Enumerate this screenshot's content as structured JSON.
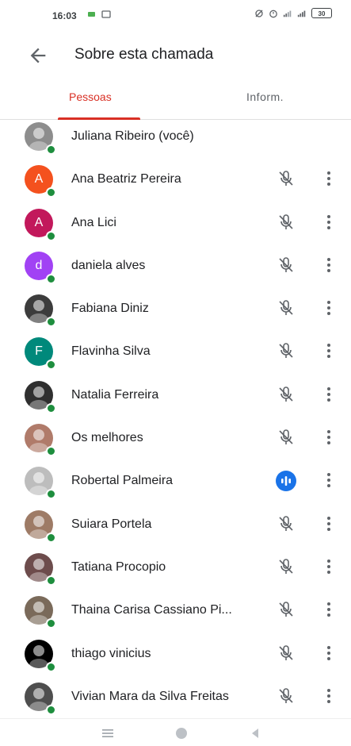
{
  "status_bar": {
    "time": "16:03",
    "battery": "30"
  },
  "header": {
    "title": "Sobre esta chamada",
    "back_icon": "arrow-back-icon"
  },
  "tabs": [
    {
      "label": "Pessoas",
      "active": true
    },
    {
      "label": "Inform.",
      "active": false
    }
  ],
  "participants": [
    {
      "name": "Juliana Ribeiro (você)",
      "avatar_type": "photo",
      "avatar_color": "#8d8d8d",
      "initial": "",
      "mic": "none"
    },
    {
      "name": "Ana Beatriz Pereira",
      "avatar_type": "initial",
      "avatar_color": "#f4511e",
      "initial": "A",
      "mic": "muted"
    },
    {
      "name": "Ana Lici",
      "avatar_type": "initial",
      "avatar_color": "#c2185b",
      "initial": "A",
      "mic": "muted"
    },
    {
      "name": "daniela alves",
      "avatar_type": "initial",
      "avatar_color": "#a142f4",
      "initial": "d",
      "mic": "muted"
    },
    {
      "name": "Fabiana Diniz",
      "avatar_type": "photo",
      "avatar_color": "#3c3c3c",
      "initial": "",
      "mic": "muted"
    },
    {
      "name": "Flavinha Silva",
      "avatar_type": "initial",
      "avatar_color": "#00897b",
      "initial": "F",
      "mic": "muted"
    },
    {
      "name": "Natalia Ferreira",
      "avatar_type": "photo",
      "avatar_color": "#2f2f2f",
      "initial": "",
      "mic": "muted"
    },
    {
      "name": "Os melhores",
      "avatar_type": "photo",
      "avatar_color": "#b07b6a",
      "initial": "",
      "mic": "muted"
    },
    {
      "name": "Robertal Palmeira",
      "avatar_type": "photo",
      "avatar_color": "#bdbdbd",
      "initial": "",
      "mic": "speaking"
    },
    {
      "name": "Suiara Portela",
      "avatar_type": "photo",
      "avatar_color": "#9e7b66",
      "initial": "",
      "mic": "muted"
    },
    {
      "name": "Tatiana Procopio",
      "avatar_type": "photo",
      "avatar_color": "#6d4c4c",
      "initial": "",
      "mic": "muted"
    },
    {
      "name": "Thaina Carisa Cassiano Pi...",
      "avatar_type": "photo",
      "avatar_color": "#7a6a5a",
      "initial": "",
      "mic": "muted"
    },
    {
      "name": "thiago vinicius",
      "avatar_type": "photo",
      "avatar_color": "#000000",
      "initial": "",
      "mic": "muted"
    },
    {
      "name": "Vivian Mara da Silva Freitas",
      "avatar_type": "photo",
      "avatar_color": "#4e4e4e",
      "initial": "",
      "mic": "muted"
    }
  ],
  "icons": {
    "muted_mic": "mic-off-icon",
    "speaking": "audio-wave-icon",
    "more": "more-vert-icon"
  },
  "colors": {
    "accent": "#d93025",
    "presence": "#1e8e3e",
    "speaking": "#1a73e8"
  }
}
